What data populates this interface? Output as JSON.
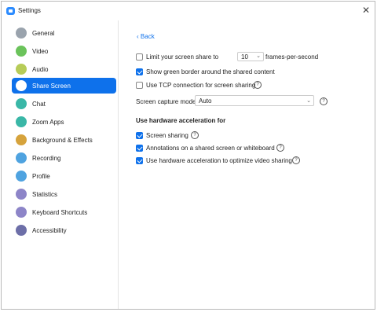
{
  "window": {
    "title": "Settings"
  },
  "sidebar": {
    "items": [
      {
        "label": "General",
        "icon": "gear-icon",
        "color": "#9aa3ad"
      },
      {
        "label": "Video",
        "icon": "video-icon",
        "color": "#6bc35b"
      },
      {
        "label": "Audio",
        "icon": "headphones-icon",
        "color": "#b7cc58"
      },
      {
        "label": "Share Screen",
        "icon": "share-screen-icon",
        "color": "#ffffff"
      },
      {
        "label": "Chat",
        "icon": "chat-icon",
        "color": "#3ab7a7"
      },
      {
        "label": "Zoom Apps",
        "icon": "zoom-apps-icon",
        "color": "#3ab7a7"
      },
      {
        "label": "Background & Effects",
        "icon": "background-icon",
        "color": "#d6a33c"
      },
      {
        "label": "Recording",
        "icon": "recording-icon",
        "color": "#4fa3e0"
      },
      {
        "label": "Profile",
        "icon": "profile-icon",
        "color": "#4fa3e0"
      },
      {
        "label": "Statistics",
        "icon": "statistics-icon",
        "color": "#8d85c8"
      },
      {
        "label": "Keyboard Shortcuts",
        "icon": "keyboard-icon",
        "color": "#8d85c8"
      },
      {
        "label": "Accessibility",
        "icon": "accessibility-icon",
        "color": "#6d6fa8"
      }
    ],
    "active_index": 3
  },
  "content": {
    "back_label": "Back",
    "limit_share": {
      "label": "Limit your screen share to",
      "checked": false,
      "fps_value": "10",
      "fps_unit": "frames-per-second"
    },
    "green_border": {
      "label": "Show green border around the shared content",
      "checked": true
    },
    "tcp": {
      "label": "Use TCP connection for screen sharing",
      "checked": false
    },
    "capture_mode": {
      "label": "Screen capture mode",
      "value": "Auto"
    },
    "hw_heading": "Use hardware acceleration for",
    "hw_screen_sharing": {
      "label": "Screen sharing",
      "checked": true
    },
    "hw_annotations": {
      "label": "Annotations on a shared screen or whiteboard",
      "checked": true
    },
    "hw_video_sharing": {
      "label": "Use hardware acceleration to optimize video sharing",
      "checked": true
    },
    "help_symbol": "?"
  },
  "colors": {
    "accent": "#0e71eb",
    "brand": "#2d8cff"
  }
}
